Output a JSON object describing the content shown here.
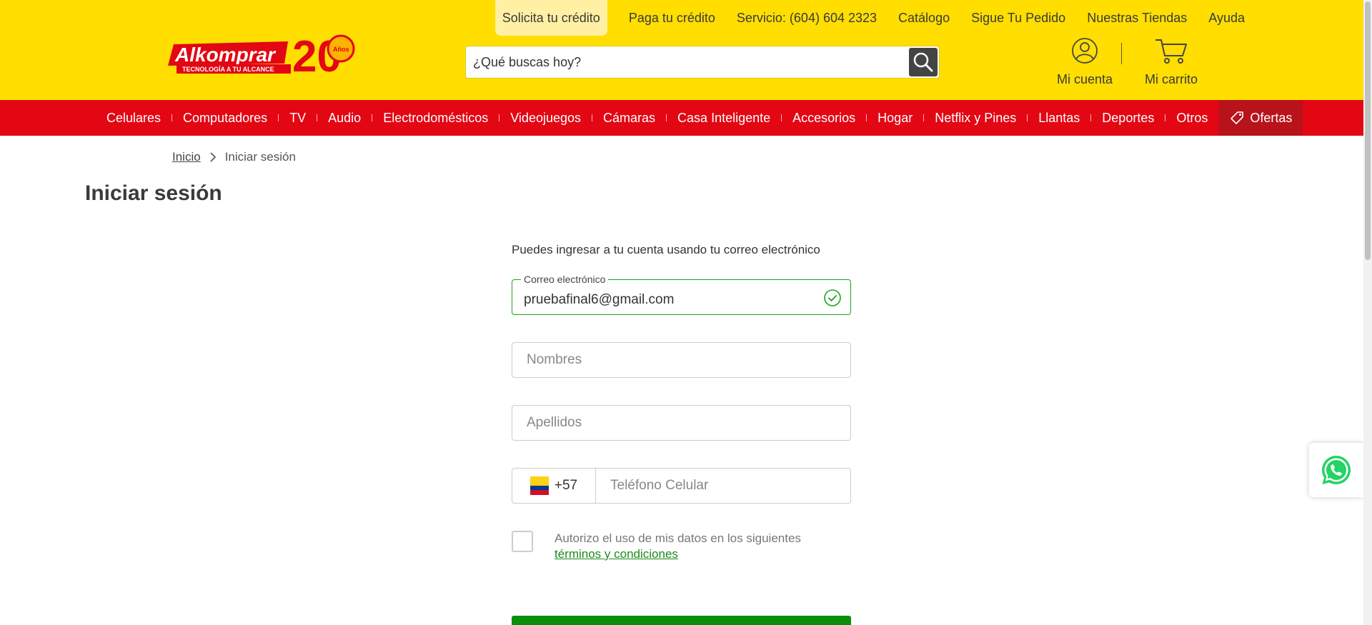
{
  "header": {
    "logo_text": "Alkomprar",
    "logo_tagline": "TECNOLOGÍA A TU ALCANCE",
    "logo_anniversary": "20",
    "logo_anniversary_sub": "Años",
    "top_links": [
      "Solicita tu crédito",
      "Paga tu crédito",
      "Servicio: (604) 604 2323",
      "Catálogo",
      "Sigue Tu Pedido",
      "Nuestras Tiendas",
      "Ayuda"
    ],
    "search_placeholder": "¿Qué buscas hoy?",
    "account_label": "Mi cuenta",
    "cart_label": "Mi carrito"
  },
  "nav": {
    "items": [
      "Celulares",
      "Computadores",
      "TV",
      "Audio",
      "Electrodomésticos",
      "Videojuegos",
      "Cámaras",
      "Casa Inteligente",
      "Accesorios",
      "Hogar",
      "Netflix y Pines",
      "Llantas",
      "Deportes",
      "Otros"
    ],
    "offers_label": "Ofertas"
  },
  "breadcrumb": {
    "home": "Inicio",
    "current": "Iniciar sesión"
  },
  "page_title": "Iniciar sesión",
  "form": {
    "intro": "Puedes ingresar a tu cuenta usando tu correo electrónico",
    "email_label": "Correo electrónico",
    "email_value": "pruebafinal6@gmail.com",
    "names_placeholder": "Nombres",
    "surnames_placeholder": "Apellidos",
    "country_code": "+57",
    "phone_placeholder": "Teléfono Celular",
    "consent_text": "Autorizo el uso de mis datos en los siguientes",
    "consent_link": "términos y condiciones"
  },
  "colors": {
    "header_yellow": "#ffde00",
    "nav_red": "#e30613",
    "valid_green": "#1ea31e",
    "submit_green": "#0a8f0a"
  }
}
